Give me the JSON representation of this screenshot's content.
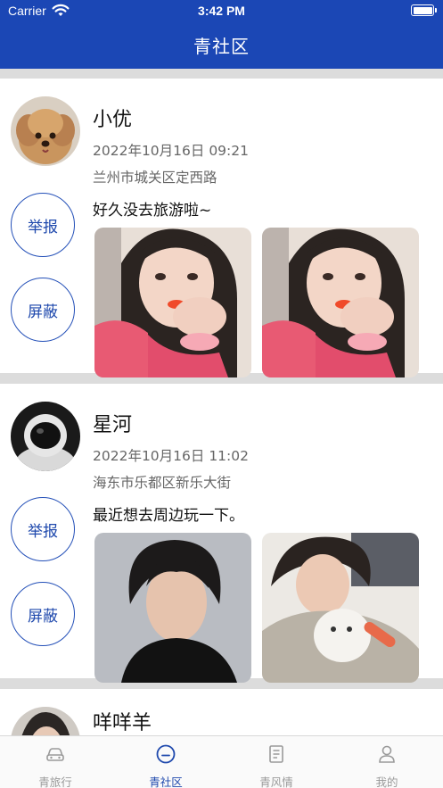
{
  "status_bar": {
    "carrier": "Carrier",
    "time": "3:42 PM"
  },
  "header": {
    "title": "青社区"
  },
  "colors": {
    "primary": "#1b47b5",
    "tab_inactive": "#9a9a9a",
    "separator": "#dcdcdc"
  },
  "posts": [
    {
      "name": "小优",
      "datetime": "2022年10月16日  09:21",
      "location": "兰州市城关区定西路",
      "text": "好久没去旅游啦~",
      "report_label": "举报",
      "block_label": "屏蔽",
      "avatar_icon": "poodle-avatar",
      "photos": [
        "girl-portrait-photo",
        "girl-portrait-photo"
      ]
    },
    {
      "name": "星河",
      "datetime": "2022年10月16日  11:02",
      "location": "海东市乐都区新乐大街",
      "text": "最近想去周边玩一下。",
      "report_label": "举报",
      "block_label": "屏蔽",
      "avatar_icon": "astronaut-avatar",
      "photos": [
        "boy-portrait-photo",
        "boy-with-cat-photo"
      ]
    },
    {
      "name": "咩咩羊",
      "avatar_icon": "person-avatar"
    }
  ],
  "tabbar": {
    "tabs": [
      {
        "label": "青旅行",
        "icon": "car-icon",
        "active": false
      },
      {
        "label": "青社区",
        "icon": "smile-circle-icon",
        "active": true
      },
      {
        "label": "青风情",
        "icon": "document-icon",
        "active": false
      },
      {
        "label": "我的",
        "icon": "person-icon",
        "active": false
      }
    ]
  }
}
